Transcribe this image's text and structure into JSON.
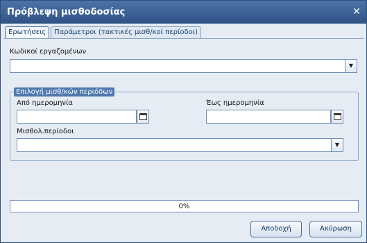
{
  "window": {
    "title": "Πρόβλεψη μισθοδοσίας",
    "close_glyph": "✕"
  },
  "tabs": [
    {
      "label": "Ερωτήσεις",
      "active": true
    },
    {
      "label": "Παράμετροι (τακτικές μισθ/κοί περίοδοι)",
      "active": false
    }
  ],
  "form": {
    "employee_codes_label": "Κωδικοί εργαζομένων",
    "employee_codes_value": "",
    "period_group_legend": "Επιλογή μισθ/κών περιόδων",
    "from_date_label": "Από ημερομηνία",
    "from_date_value": "",
    "to_date_label": "Έως ημερομηνία",
    "to_date_value": "",
    "payroll_periods_label": "Μισθολ.περίοδοι",
    "payroll_periods_value": ""
  },
  "progress": {
    "percent": 0,
    "text": "0%"
  },
  "buttons": {
    "accept_label": "Αποδοχή",
    "cancel_label": "Ακύρωση"
  },
  "icons": {
    "dropdown": "chevron-down-icon",
    "calendar": "calendar-icon",
    "close": "close-icon"
  },
  "colors": {
    "titlebar": "#3a5f92",
    "legend": "#4f79ad",
    "border": "#6e8fb6"
  }
}
